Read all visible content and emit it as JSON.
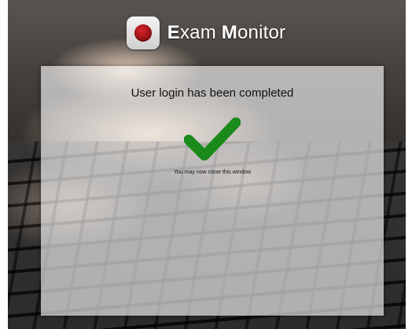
{
  "header": {
    "icon": "record-icon",
    "title_first_letter_1": "E",
    "title_rest_1": "xam",
    "title_first_letter_2": "M",
    "title_rest_2": "onitor"
  },
  "panel": {
    "heading": "User login has been completed",
    "status_icon": "checkmark-icon",
    "message": "You may now close this window"
  },
  "colors": {
    "check": "#1a8a1a",
    "record_dot": "#b0141a"
  }
}
